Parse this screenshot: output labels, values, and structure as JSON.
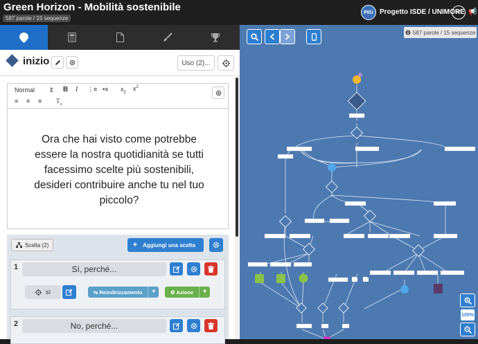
{
  "app": {
    "title": "Green Horizon - Mobilità sostenibile",
    "words_badge": "587 parole / 15 sequenze",
    "avatar_initials": "PI/U",
    "project": "Progetto ISDE / UNIMORE",
    "language": "IT"
  },
  "tabs": [
    {
      "icon": "map-marker-icon",
      "glyph": "⬤",
      "active": true
    },
    {
      "icon": "calculator-icon",
      "glyph": "▦",
      "active": false
    },
    {
      "icon": "file-icon",
      "glyph": "▢",
      "active": false
    },
    {
      "icon": "brush-icon",
      "glyph": "✎",
      "active": false
    },
    {
      "icon": "trophy-icon",
      "glyph": "♛",
      "active": false
    }
  ],
  "sequence": {
    "name": "inizio",
    "uso_label": "Uso (2)..."
  },
  "editor": {
    "format_select": "Normal",
    "body": "Ora che hai visto come potrebbe essere la nostra quotidianità se tutti facessimo scelte più sostenibili, desideri contribuire anche tu nel tuo piccolo?"
  },
  "choices_panel": {
    "label": "Scelta (2)",
    "add_label": "Aggiungi una scelta",
    "items": [
      {
        "number": "1",
        "text": "Sì, perché...",
        "condition": "sì",
        "redirect_label": "Reindirizzamento",
        "action_label": "Azione"
      },
      {
        "number": "2",
        "text": "No, perché..."
      }
    ]
  },
  "map": {
    "stats": "587 parole / 15 sequenze",
    "zoom_label": "100%"
  },
  "colors": {
    "accent": "#2f7fd1",
    "map_bg": "#4d79b1",
    "danger": "#d9362b",
    "success": "#6ab04c",
    "teal": "#5aa0c9"
  }
}
